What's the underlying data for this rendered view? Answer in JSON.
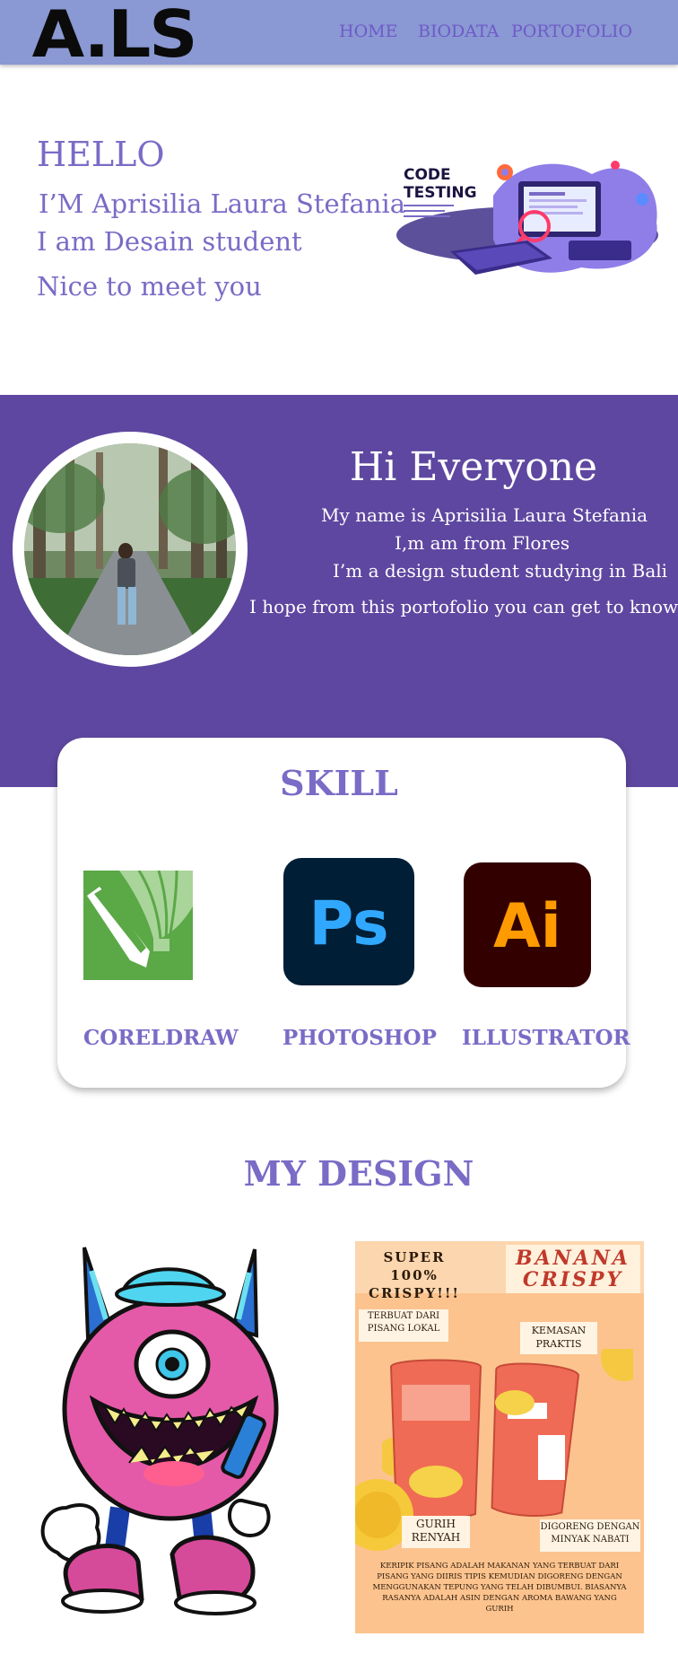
{
  "header": {
    "logo": "A.LS",
    "nav": [
      {
        "label": "HOME"
      },
      {
        "label": "BIODATA"
      },
      {
        "label": "PORTOFOLIO"
      }
    ]
  },
  "hero": {
    "hello": "HELLO",
    "name_line": "I’M Aprisilia Laura Stefania",
    "line2": "I am Desain student",
    "line3": "Nice to meet you",
    "illustration": {
      "title_line1": "CODE",
      "title_line2": "TESTING"
    }
  },
  "about": {
    "title": "Hi Everyone",
    "lines": [
      "My name is Aprisilia Laura Stefania",
      "I,m am from Flores",
      "I’m a design student studying in Bali",
      "I hope from this portofolio you can get to know me"
    ]
  },
  "skills": {
    "title": "SKILL",
    "items": [
      {
        "label": "CORELDRAW",
        "icon": "coreldraw-icon"
      },
      {
        "label": "PHOTOSHOP",
        "icon": "photoshop-icon",
        "icon_text": "Ps"
      },
      {
        "label": "ILLUSTRATOR",
        "icon": "illustrator-icon",
        "icon_text": "Ai"
      }
    ]
  },
  "design": {
    "title": "MY DESIGN",
    "poster": {
      "tagline": "SUPER 100% CRISPY!!!",
      "brand_line1": "BANANA",
      "brand_line2": "CRISPY",
      "badge_left": "TERBUAT DARI PISANG LOKAL",
      "badge_right": "KEMASAN PRAKTIS",
      "bottom_left": "GURIH RENYAH",
      "bottom_right": "DIGORENG DENGAN MINYAK NABATI",
      "footer": "KERIPIK PISANG ADALAH MAKANAN YANG TERBUAT DARI PISANG YANG DIIRIS TIPIS KEMUDIAN DIGORENG DENGAN MENGGUNAKAN TEPUNG YANG TELAH DIBUMBUI. BIASANYA RASANYA ADALAH ASIN DENGAN AROMA BAWANG YANG GURIH"
    }
  },
  "colors": {
    "header_bg": "#8a98d3",
    "accent": "#7a6bc6",
    "about_bg": "#5e47a0"
  }
}
